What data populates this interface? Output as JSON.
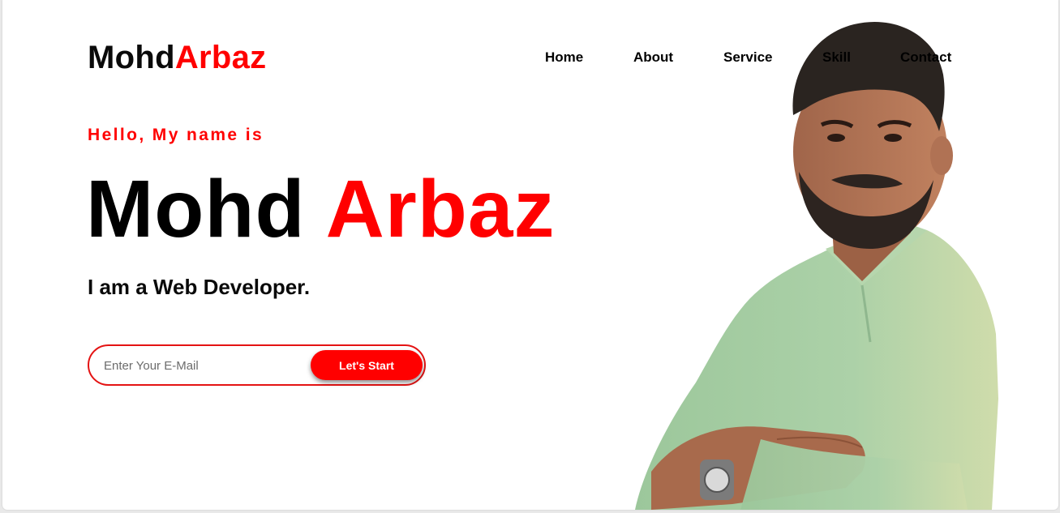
{
  "brand": {
    "part1": "Mohd",
    "part2": "Arbaz"
  },
  "nav": {
    "items": [
      "Home",
      "About",
      "Service",
      "Skill",
      "Contact"
    ]
  },
  "hero": {
    "greeting": "Hello, My name is",
    "name_first": "Mohd",
    "name_last": "Arbaz",
    "role": "I am a Web Developer."
  },
  "signup": {
    "email_placeholder": "Enter Your E-Mail",
    "email_value": "",
    "button_label": "Let's Start"
  },
  "colors": {
    "accent": "#ff0000",
    "text": "#000000",
    "background": "#ffffff",
    "shirt": "#a9cfa6"
  },
  "icons": {
    "profile_photo": "person-portrait"
  }
}
